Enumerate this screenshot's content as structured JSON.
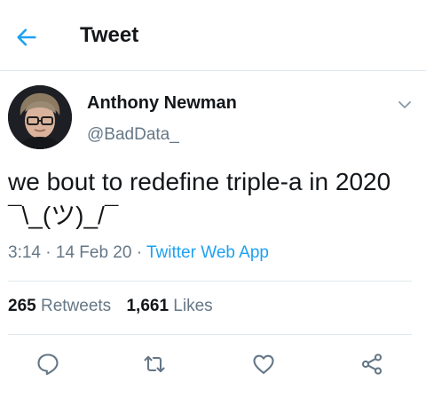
{
  "header": {
    "title": "Tweet",
    "back_icon": "arrow-left-icon",
    "accent": "#1da1f2"
  },
  "tweet": {
    "author_name": "Anthony Newman",
    "author_handle": "@BadData_",
    "text": "we bout to redefine triple-a in 2020 ¯\\_(ツ)_/¯",
    "time": "3:14",
    "date": "14 Feb 20",
    "source": "Twitter Web App",
    "retweets_count": "265",
    "retweets_label": "Retweets",
    "likes_count": "1,661",
    "likes_label": "Likes"
  },
  "actions": [
    "reply-icon",
    "retweet-icon",
    "like-icon",
    "share-icon"
  ]
}
